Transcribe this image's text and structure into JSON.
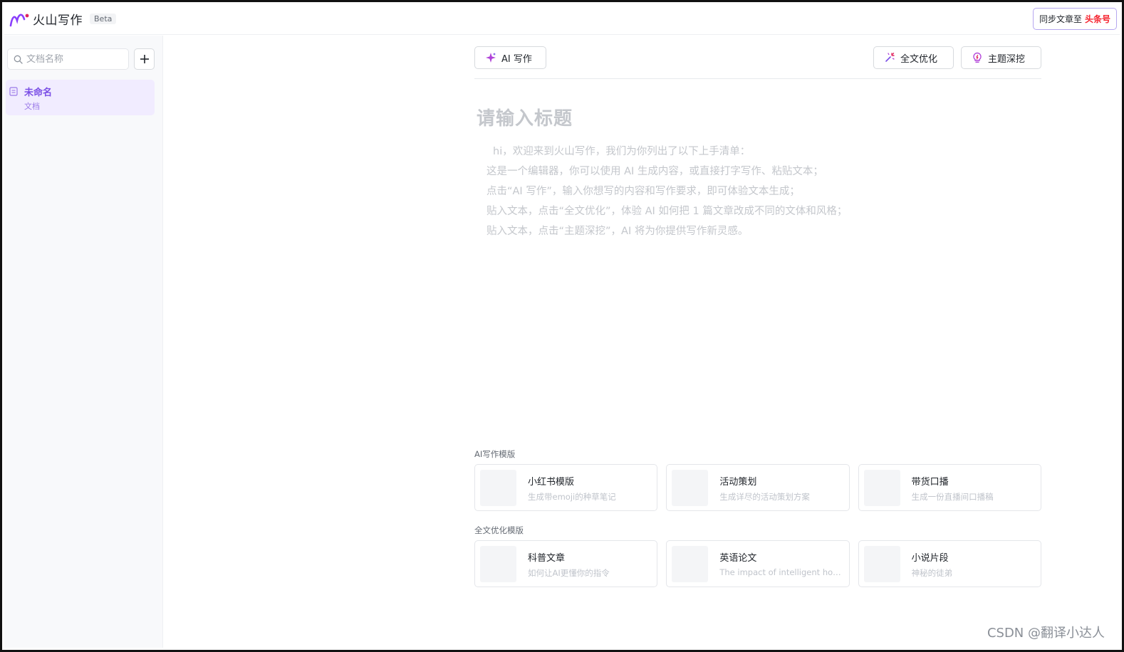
{
  "header": {
    "app_name": "火山写作",
    "beta_badge": "Beta",
    "sync": {
      "label": "同步文章至",
      "target": "头条号"
    }
  },
  "sidebar": {
    "search_placeholder": "文档名称",
    "documents": [
      {
        "title": "未命名",
        "subtitle": "文档"
      }
    ]
  },
  "toolbar": {
    "ai_write": "AI 写作",
    "full_optimize": "全文优化",
    "topic_dig": "主题深挖"
  },
  "editor": {
    "title_placeholder": "请输入标题",
    "intro_lines": [
      "hi，欢迎来到火山写作，我们为你列出了以下上手清单：",
      "这是一个编辑器，你可以使用 AI 生成内容，或直接打字写作、粘贴文本；",
      "点击“AI 写作”，输入你想写的内容和写作要求，即可体验文本生成；",
      "贴入文本，点击“全文优化”，体验 AI 如何把 1 篇文章改成不同的文体和风格；",
      "贴入文本，点击“主题深挖”，AI 将为你提供写作新灵感。"
    ]
  },
  "templates": {
    "ai_section": "AI写作模版",
    "ai_cards": [
      {
        "name": "小红书模版",
        "desc": "生成带emoji的种草笔记"
      },
      {
        "name": "活动策划",
        "desc": "生成详尽的活动策划方案"
      },
      {
        "name": "带货口播",
        "desc": "生成一份直播间口播稿"
      }
    ],
    "opt_section": "全文优化模版",
    "opt_cards": [
      {
        "name": "科普文章",
        "desc": "如何让AI更懂你的指令"
      },
      {
        "name": "英语论文",
        "desc": "The impact of intelligent hou···"
      },
      {
        "name": "小说片段",
        "desc": "神秘的徒弟"
      }
    ]
  },
  "watermark": "CSDN @翻译小达人",
  "colors": {
    "accent": "#7a4ee6",
    "brand_red": "#f5222d",
    "selected_bg": "#f1ecff"
  }
}
